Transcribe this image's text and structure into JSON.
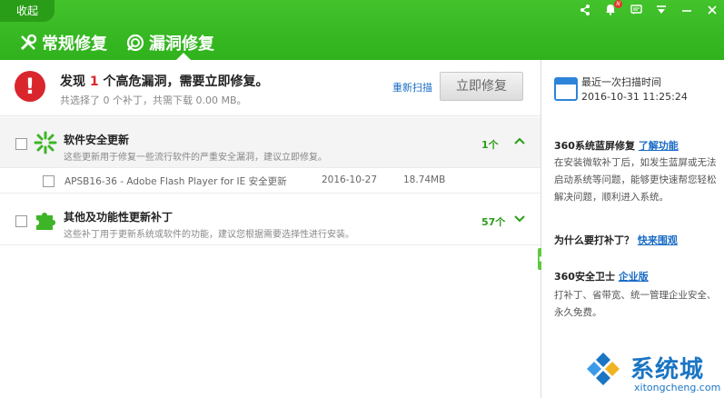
{
  "header": {
    "collapse_label": "收起",
    "tabs": [
      {
        "label": "常规修复",
        "icon": "wrench-screwdriver-icon"
      },
      {
        "label": "漏洞修复",
        "icon": "shield-bug-icon"
      }
    ],
    "window_controls": {
      "share": "share-icon",
      "notify": "notification-icon",
      "notify_badge": "N",
      "feedback": "feedback-icon",
      "menu": "menu-icon",
      "minimize": "minimize-icon",
      "close": "close-icon"
    },
    "accent_color": "#2fb21c"
  },
  "alert": {
    "prefix": "发现",
    "count": "1",
    "suffix": "个高危漏洞，需要立即修复。",
    "subtext": "共选择了 0 个补丁，共需下载 0.00 MB。",
    "rescan_label": "重新扫描",
    "fix_label": "立即修复"
  },
  "categories": [
    {
      "title": "软件安全更新",
      "desc": "这些更新用于修复一些流行软件的严重安全漏洞，建议立即修复。",
      "count": "1个",
      "icon": "spark-icon"
    },
    {
      "title": "其他及功能性更新补丁",
      "desc": "这些补丁用于更新系统或软件的功能，建议您根据需要选择性进行安装。",
      "count": "57个",
      "icon": "puzzle-icon"
    }
  ],
  "patch": {
    "name": "APSB16-36 - Adobe Flash Player for IE 安全更新",
    "date": "2016-10-27",
    "size": "18.74MB"
  },
  "side": {
    "scan_label": "最近一次扫描时间",
    "scan_time": "2016-10-31 11:25:24",
    "bsod_title": "360系统蓝屏修复",
    "bsod_link": "了解功能",
    "bsod_text": "在安装微软补丁后，如发生蓝屏或无法启动系统等问题，能够更快速帮您轻松解决问题，顺利进入系统。",
    "why_title": "为什么要打补丁？",
    "why_link": "快来围观",
    "ent_title": "360安全卫士",
    "ent_link": "企业版",
    "ent_text": "打补丁、省带宽、统一管理企业安全、永久免费。"
  },
  "watermark": {
    "name": "系统城",
    "url": "xitongcheng.com"
  }
}
